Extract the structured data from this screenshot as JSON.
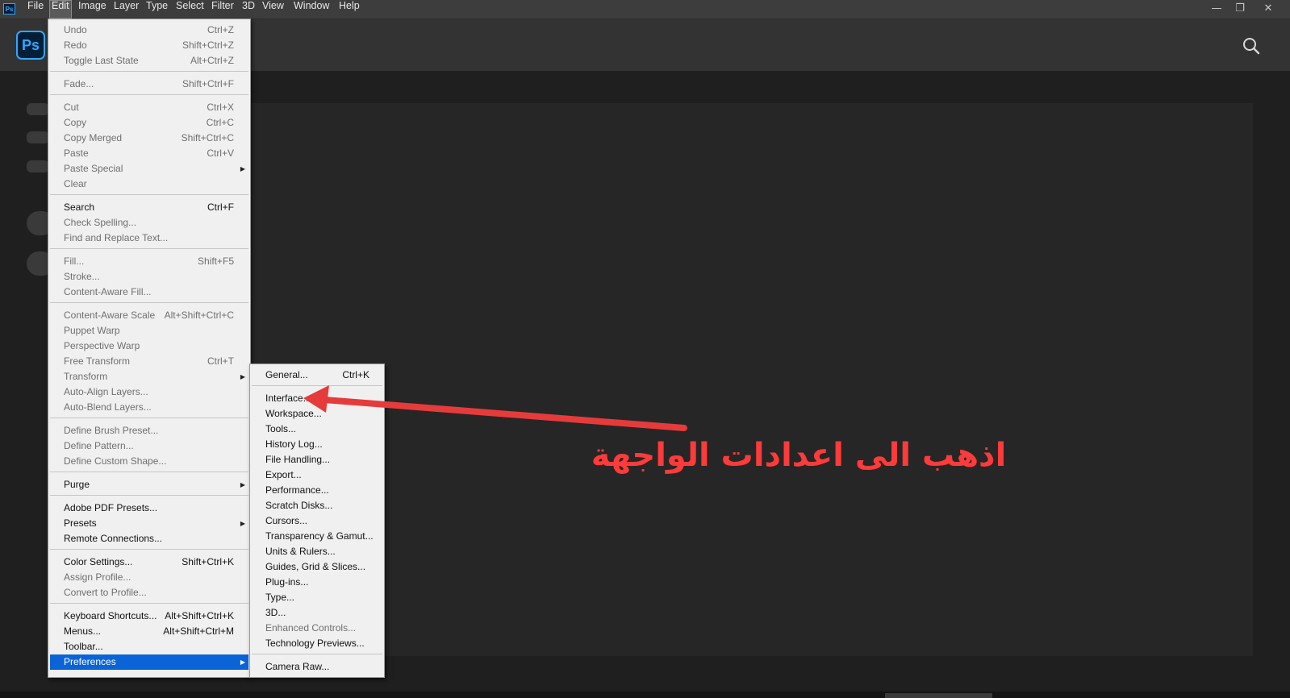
{
  "menubar": {
    "app_icon": "Ps",
    "items": [
      "File",
      "Edit",
      "Image",
      "Layer",
      "Type",
      "Select",
      "Filter",
      "3D",
      "View",
      "Window",
      "Help"
    ],
    "active": "Edit",
    "window_controls": [
      "minimize-icon",
      "restore-icon",
      "close-icon"
    ]
  },
  "header": {
    "logo_text": "Ps",
    "search_icon": "search-icon"
  },
  "edit_menu": {
    "items": [
      {
        "label": "Undo",
        "shortcut": "Ctrl+Z",
        "disabled": true
      },
      {
        "label": "Redo",
        "shortcut": "Shift+Ctrl+Z",
        "disabled": true
      },
      {
        "label": "Toggle Last State",
        "shortcut": "Alt+Ctrl+Z",
        "disabled": true
      },
      {
        "separator": true
      },
      {
        "label": "Fade...",
        "shortcut": "Shift+Ctrl+F",
        "disabled": true
      },
      {
        "separator": true
      },
      {
        "label": "Cut",
        "shortcut": "Ctrl+X",
        "disabled": true
      },
      {
        "label": "Copy",
        "shortcut": "Ctrl+C",
        "disabled": true
      },
      {
        "label": "Copy Merged",
        "shortcut": "Shift+Ctrl+C",
        "disabled": true
      },
      {
        "label": "Paste",
        "shortcut": "Ctrl+V",
        "disabled": true
      },
      {
        "label": "Paste Special",
        "shortcut": "",
        "disabled": true,
        "submenu": true
      },
      {
        "label": "Clear",
        "shortcut": "",
        "disabled": true
      },
      {
        "separator": true
      },
      {
        "label": "Search",
        "shortcut": "Ctrl+F",
        "disabled": false
      },
      {
        "label": "Check Spelling...",
        "shortcut": "",
        "disabled": true
      },
      {
        "label": "Find and Replace Text...",
        "shortcut": "",
        "disabled": true
      },
      {
        "separator": true
      },
      {
        "label": "Fill...",
        "shortcut": "Shift+F5",
        "disabled": true
      },
      {
        "label": "Stroke...",
        "shortcut": "",
        "disabled": true
      },
      {
        "label": "Content-Aware Fill...",
        "shortcut": "",
        "disabled": true
      },
      {
        "separator": true
      },
      {
        "label": "Content-Aware Scale",
        "shortcut": "Alt+Shift+Ctrl+C",
        "disabled": true
      },
      {
        "label": "Puppet Warp",
        "shortcut": "",
        "disabled": true
      },
      {
        "label": "Perspective Warp",
        "shortcut": "",
        "disabled": true
      },
      {
        "label": "Free Transform",
        "shortcut": "Ctrl+T",
        "disabled": true
      },
      {
        "label": "Transform",
        "shortcut": "",
        "disabled": true,
        "submenu": true
      },
      {
        "label": "Auto-Align Layers...",
        "shortcut": "",
        "disabled": true
      },
      {
        "label": "Auto-Blend Layers...",
        "shortcut": "",
        "disabled": true
      },
      {
        "separator": true
      },
      {
        "label": "Define Brush Preset...",
        "shortcut": "",
        "disabled": true
      },
      {
        "label": "Define Pattern...",
        "shortcut": "",
        "disabled": true
      },
      {
        "label": "Define Custom Shape...",
        "shortcut": "",
        "disabled": true
      },
      {
        "separator": true
      },
      {
        "label": "Purge",
        "shortcut": "",
        "disabled": false,
        "submenu": true
      },
      {
        "separator": true
      },
      {
        "label": "Adobe PDF Presets...",
        "shortcut": "",
        "disabled": false
      },
      {
        "label": "Presets",
        "shortcut": "",
        "disabled": false,
        "submenu": true
      },
      {
        "label": "Remote Connections...",
        "shortcut": "",
        "disabled": false
      },
      {
        "separator": true
      },
      {
        "label": "Color Settings...",
        "shortcut": "Shift+Ctrl+K",
        "disabled": false
      },
      {
        "label": "Assign Profile...",
        "shortcut": "",
        "disabled": true
      },
      {
        "label": "Convert to Profile...",
        "shortcut": "",
        "disabled": true
      },
      {
        "separator": true
      },
      {
        "label": "Keyboard Shortcuts...",
        "shortcut": "Alt+Shift+Ctrl+K",
        "disabled": false
      },
      {
        "label": "Menus...",
        "shortcut": "Alt+Shift+Ctrl+M",
        "disabled": false
      },
      {
        "label": "Toolbar...",
        "shortcut": "",
        "disabled": false
      },
      {
        "label": "Preferences",
        "shortcut": "",
        "disabled": false,
        "submenu": true,
        "highlighted": true
      }
    ]
  },
  "preferences_menu": {
    "items": [
      {
        "label": "General...",
        "shortcut": "Ctrl+K",
        "disabled": false
      },
      {
        "separator": true
      },
      {
        "label": "Interface...",
        "shortcut": "",
        "disabled": false
      },
      {
        "label": "Workspace...",
        "shortcut": "",
        "disabled": false
      },
      {
        "label": "Tools...",
        "shortcut": "",
        "disabled": false
      },
      {
        "label": "History Log...",
        "shortcut": "",
        "disabled": false
      },
      {
        "label": "File Handling...",
        "shortcut": "",
        "disabled": false
      },
      {
        "label": "Export...",
        "shortcut": "",
        "disabled": false
      },
      {
        "label": "Performance...",
        "shortcut": "",
        "disabled": false
      },
      {
        "label": "Scratch Disks...",
        "shortcut": "",
        "disabled": false
      },
      {
        "label": "Cursors...",
        "shortcut": "",
        "disabled": false
      },
      {
        "label": "Transparency & Gamut...",
        "shortcut": "",
        "disabled": false
      },
      {
        "label": "Units & Rulers...",
        "shortcut": "",
        "disabled": false
      },
      {
        "label": "Guides, Grid & Slices...",
        "shortcut": "",
        "disabled": false
      },
      {
        "label": "Plug-ins...",
        "shortcut": "",
        "disabled": false
      },
      {
        "label": "Type...",
        "shortcut": "",
        "disabled": false
      },
      {
        "label": "3D...",
        "shortcut": "",
        "disabled": false
      },
      {
        "label": "Enhanced Controls...",
        "shortcut": "",
        "disabled": true
      },
      {
        "label": "Technology Previews...",
        "shortcut": "",
        "disabled": false
      },
      {
        "separator": true
      },
      {
        "label": "Camera Raw...",
        "shortcut": "",
        "disabled": false
      }
    ]
  },
  "annotation": {
    "text": "اذهب الى اعدادات الواجهة",
    "color": "#ff3a3a"
  },
  "colors": {
    "menu_highlight": "#0a64d7",
    "accent": "#31a8ff"
  }
}
